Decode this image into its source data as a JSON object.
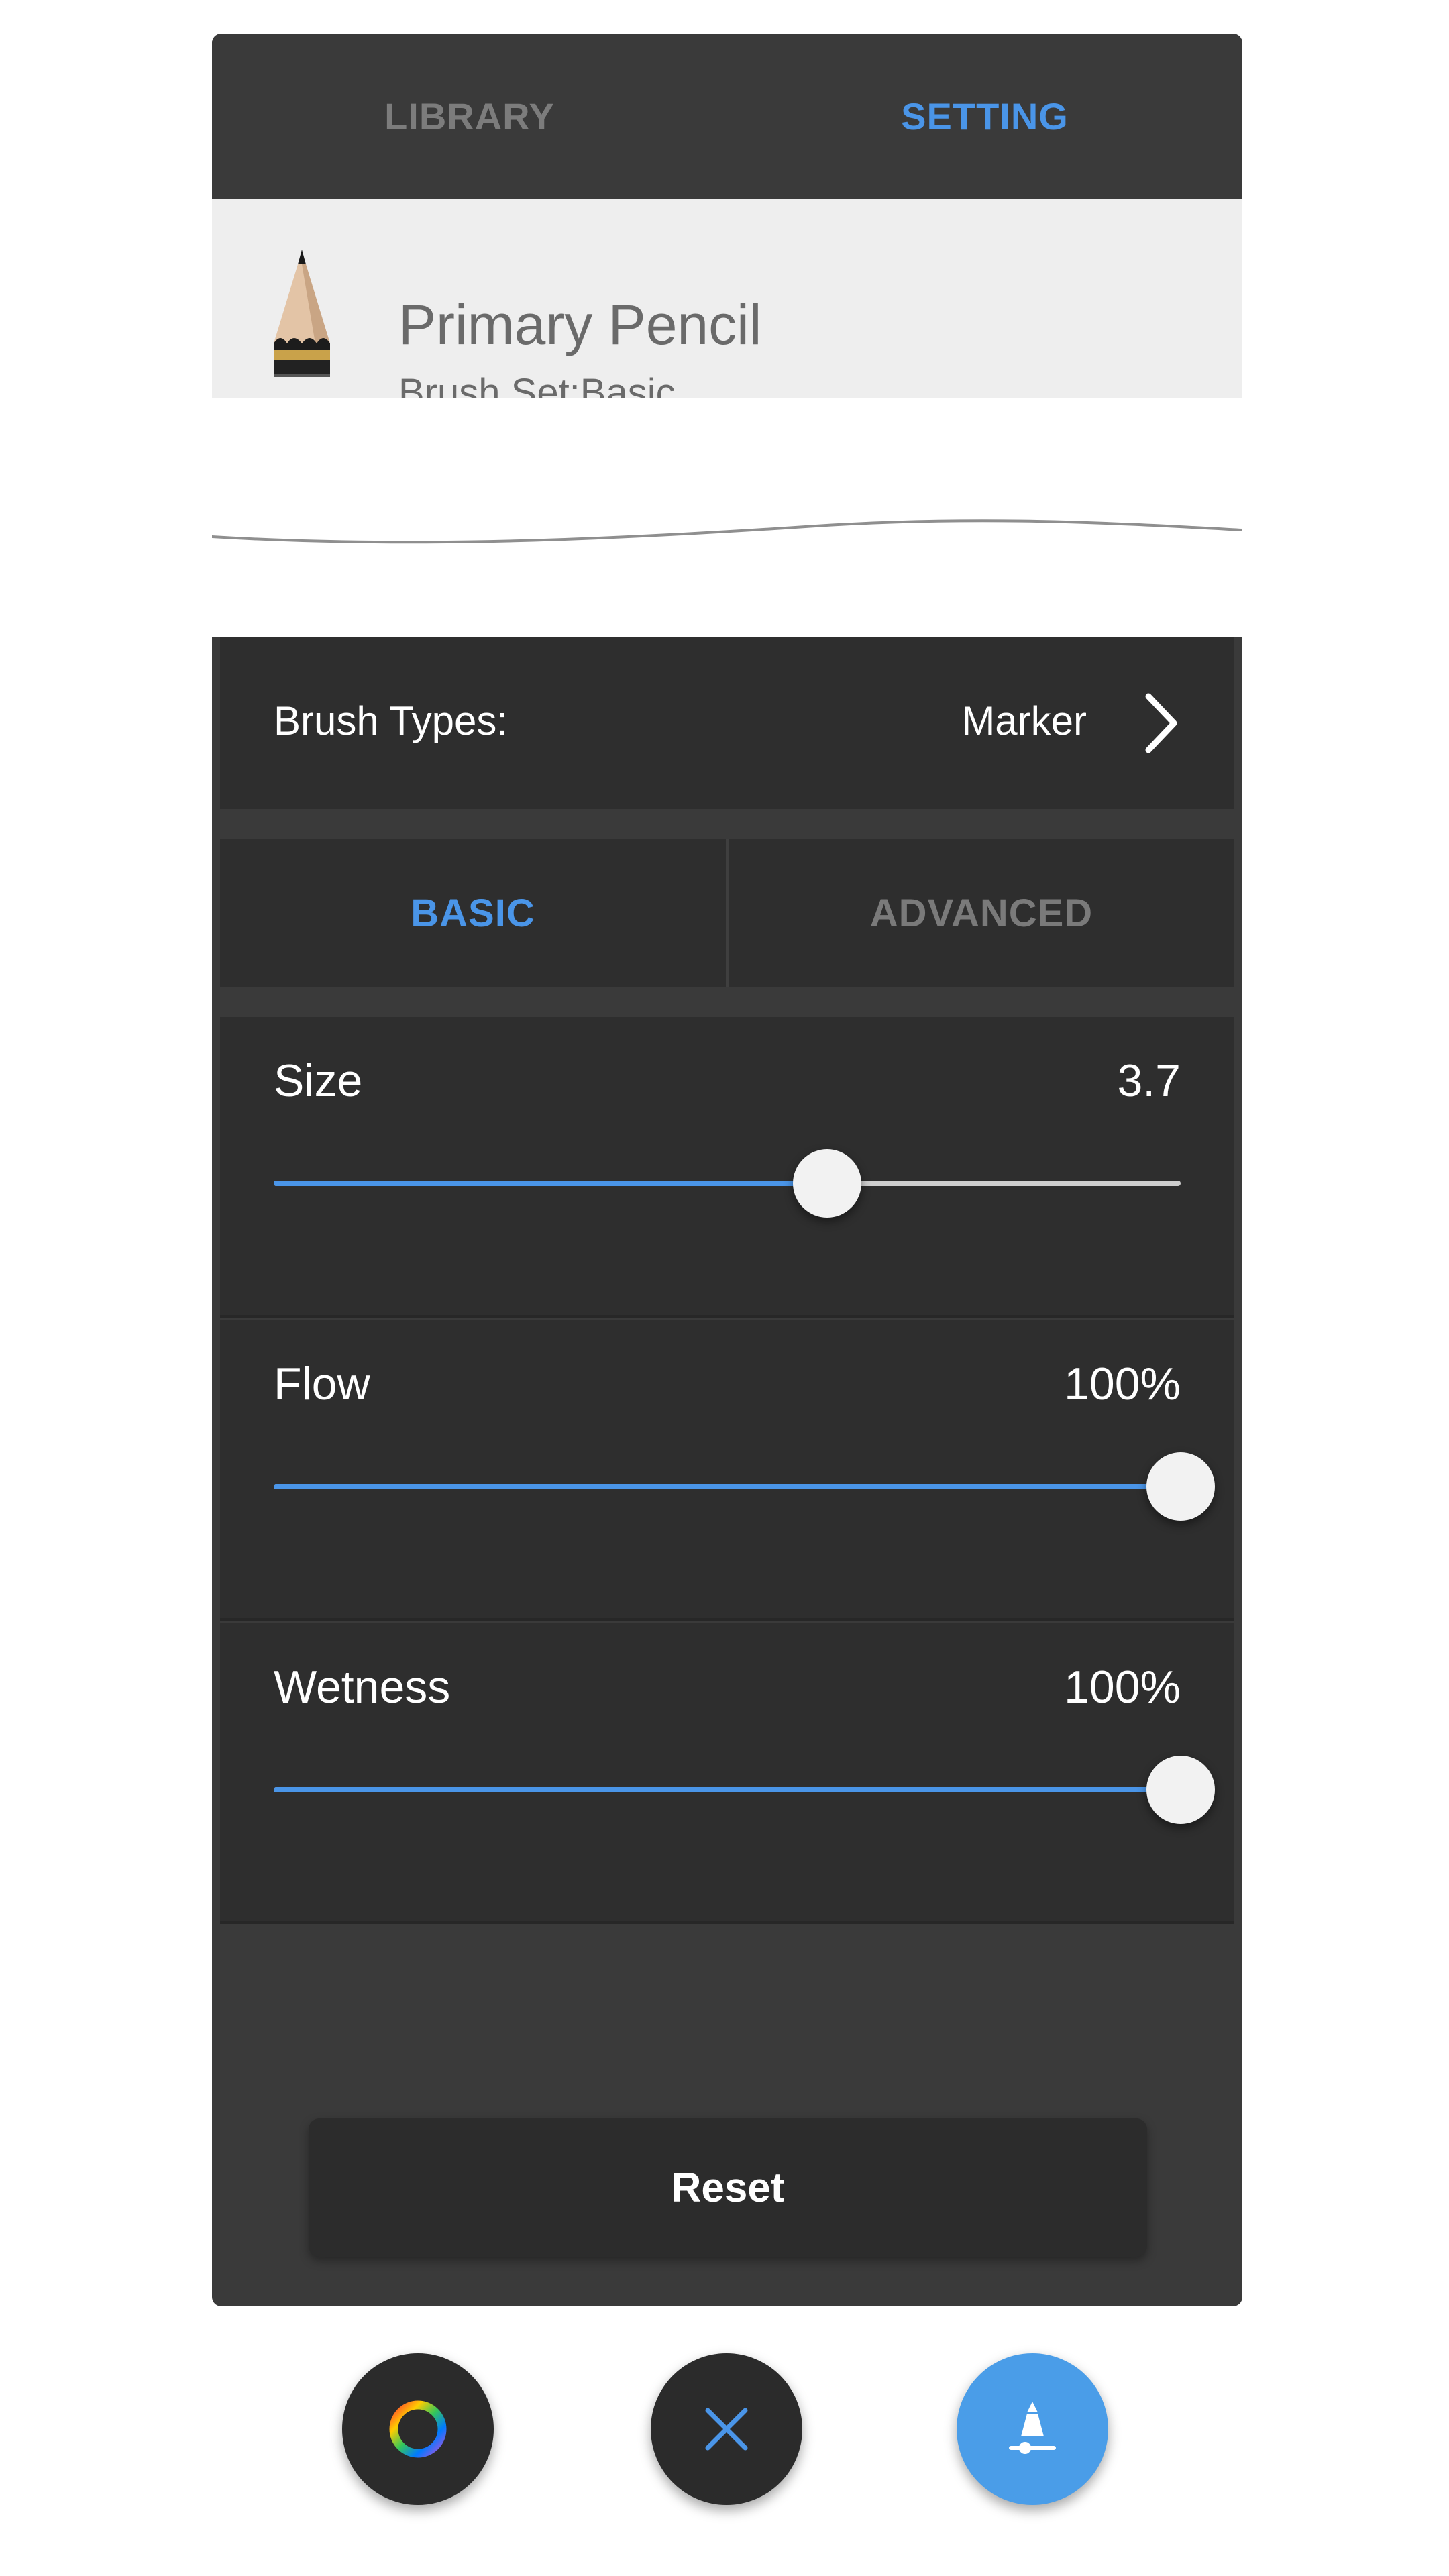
{
  "tabs": {
    "library": "LIBRARY",
    "setting": "SETTING",
    "active": "setting"
  },
  "brush": {
    "name": "Primary Pencil",
    "set": "Brush Set:Basic"
  },
  "brush_types": {
    "label": "Brush Types:",
    "value": "Marker"
  },
  "mode_tabs": {
    "basic": "BASIC",
    "advanced": "ADVANCED",
    "active": "basic"
  },
  "sliders": [
    {
      "label": "Size",
      "value": "3.7",
      "level": 0.61
    },
    {
      "label": "Flow",
      "value": "100%",
      "level": 1.0
    },
    {
      "label": "Wetness",
      "value": "100%",
      "level": 1.0
    }
  ],
  "reset_label": "Reset",
  "colors": {
    "accent": "#4a95e8",
    "panel": "#3a3a3a",
    "card": "#2e2e2e",
    "fab_blue": "#4a9de8"
  },
  "fab_icons": [
    "color-wheel-icon",
    "close-icon",
    "brush-settings-icon"
  ]
}
